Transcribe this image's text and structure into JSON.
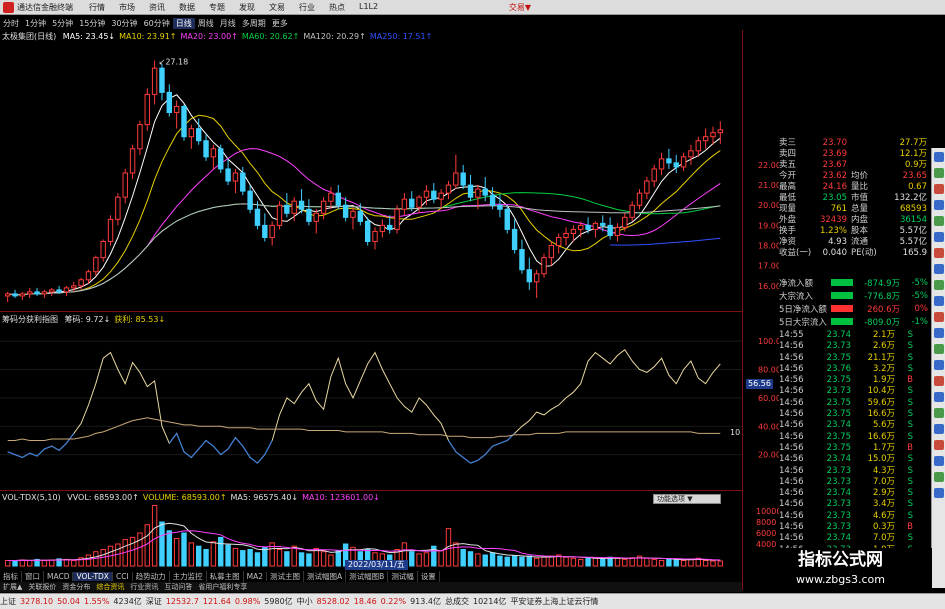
{
  "app": {
    "title": "通达信金融终端",
    "menu": [
      "行情",
      "市场",
      "资讯",
      "数据",
      "专题",
      "发现",
      "文易",
      "行业",
      "热点",
      "L1L2"
    ],
    "trade_label": "交易▼"
  },
  "periods": [
    {
      "label": "分时",
      "active": false
    },
    {
      "label": "1分钟",
      "active": false
    },
    {
      "label": "5分钟",
      "active": false
    },
    {
      "label": "15分钟",
      "active": false
    },
    {
      "label": "30分钟",
      "active": false
    },
    {
      "label": "60分钟",
      "active": false
    },
    {
      "label": "日线",
      "active": true
    },
    {
      "label": "周线",
      "active": false
    },
    {
      "label": "月线",
      "active": false
    },
    {
      "label": "多周期",
      "active": false
    },
    {
      "label": "更多",
      "active": false
    }
  ],
  "price_legend": {
    "name": "太极集团(日线)",
    "items": [
      {
        "text": "MA5: 23.45↓",
        "color": "#ffffff"
      },
      {
        "text": "MA10: 23.91↑",
        "color": "#e8d000"
      },
      {
        "text": "MA20: 23.00↑",
        "color": "#ff40ff"
      },
      {
        "text": "MA60: 20.62↑",
        "color": "#00d040"
      },
      {
        "text": "MA120: 20.29↑",
        "color": "#c0c0c0"
      },
      {
        "text": "MA250: 17.51↑",
        "color": "#3050ff"
      }
    ],
    "high_label": "27.18"
  },
  "price_axis": [
    "22.00",
    "21.00",
    "20.00",
    "19.00",
    "18.00",
    "17.00",
    "16.00"
  ],
  "indicator_legend": {
    "name": "筹码分获利指图",
    "items": [
      {
        "text": "筹码: 9.72↓",
        "color": "#e0e0e0"
      },
      {
        "text": "获利: 85.53↓",
        "color": "#e8d000"
      }
    ]
  },
  "indicator_axis": [
    "100.00",
    "80.00",
    "60.00",
    "40.00",
    "20.00"
  ],
  "indicator_marker": "56.56",
  "indicator_right_value": "10",
  "volume_legend": {
    "name": "VOL-TDX(5,10)",
    "items": [
      {
        "text": "VVOL: 68593.00↑",
        "color": "#e0e0e0"
      },
      {
        "text": "VOLUME: 68593.00↑",
        "color": "#e8d000"
      },
      {
        "text": "MA5: 96575.40↓",
        "color": "#e0e0e0"
      },
      {
        "text": "MA10: 123601.00↓",
        "color": "#ff40ff"
      }
    ]
  },
  "volume_axis": [
    "10000",
    "8000",
    "6000",
    "4000",
    "2000"
  ],
  "popup_label": "功能选项 ▼",
  "date_marker": "2022/03/11/五",
  "quote": [
    {
      "l": "卖三",
      "v": "23.70",
      "vc": "up",
      "l2": "",
      "v2": "27.7万",
      "v2c": "yl"
    },
    {
      "l": "卖四",
      "v": "23.69",
      "vc": "up",
      "l2": "",
      "v2": "12.1万",
      "v2c": "yl"
    },
    {
      "l": "卖五",
      "v": "23.67",
      "vc": "up",
      "l2": "",
      "v2": "0.9万",
      "v2c": "yl"
    },
    {
      "l": "今开",
      "v": "23.62",
      "vc": "up",
      "l2": "均价",
      "v2": "23.65",
      "v2c": "up"
    },
    {
      "l": "最高",
      "v": "24.16",
      "vc": "up",
      "l2": "量比",
      "v2": "0.67",
      "v2c": "yl"
    },
    {
      "l": "最低",
      "v": "23.05",
      "vc": "dn",
      "l2": "市值",
      "v2": "132.2亿",
      "v2c": "wh"
    },
    {
      "l": "现量",
      "v": "761",
      "vc": "yl",
      "l2": "总量",
      "v2": "68593",
      "v2c": "yl"
    },
    {
      "l": "外盘",
      "v": "32439",
      "vc": "up",
      "l2": "内盘",
      "v2": "36154",
      "v2c": "dn"
    },
    {
      "l": "换手",
      "v": "1.23%",
      "vc": "yl",
      "l2": "股本",
      "v2": "5.57亿",
      "v2c": "wh"
    },
    {
      "l": "净资",
      "v": "4.93",
      "vc": "wh",
      "l2": "流通",
      "v2": "5.57亿",
      "v2c": "wh"
    },
    {
      "l": "收益(一)",
      "v": "0.040",
      "vc": "wh",
      "l2": "PE(动)",
      "v2": "165.9",
      "v2c": "wh"
    }
  ],
  "flows": [
    {
      "l": "净流入额",
      "v": "-874.9万",
      "p": "-5%",
      "c": "dn"
    },
    {
      "l": "大宗流入",
      "v": "-776.8万",
      "p": "-5%",
      "c": "dn"
    },
    {
      "l": "5日净流入额",
      "v": "260.6万",
      "p": "0%",
      "c": "up"
    },
    {
      "l": "5日大宗流入",
      "v": "-809.0万",
      "p": "-1%",
      "c": "dn"
    }
  ],
  "ticks": [
    {
      "t": "14:55",
      "p": "23.74",
      "v": "2.1万",
      "s": "S",
      "sc": "dn"
    },
    {
      "t": "14:56",
      "p": "23.73",
      "v": "2.6万",
      "s": "S",
      "sc": "dn"
    },
    {
      "t": "14:56",
      "p": "23.75",
      "v": "21.1万",
      "s": "S",
      "sc": "dn"
    },
    {
      "t": "14:56",
      "p": "23.76",
      "v": "3.2万",
      "s": "S",
      "sc": "dn"
    },
    {
      "t": "14:56",
      "p": "23.75",
      "v": "1.9万",
      "s": "B",
      "sc": "up"
    },
    {
      "t": "14:56",
      "p": "23.73",
      "v": "10.4万",
      "s": "S",
      "sc": "dn"
    },
    {
      "t": "14:56",
      "p": "23.75",
      "v": "59.6万",
      "s": "S",
      "sc": "dn"
    },
    {
      "t": "14:56",
      "p": "23.75",
      "v": "16.6万",
      "s": "S",
      "sc": "dn"
    },
    {
      "t": "14:56",
      "p": "23.74",
      "v": "5.6万",
      "s": "S",
      "sc": "dn"
    },
    {
      "t": "14:56",
      "p": "23.75",
      "v": "16.6万",
      "s": "S",
      "sc": "dn"
    },
    {
      "t": "14:56",
      "p": "23.75",
      "v": "1.7万",
      "s": "B",
      "sc": "up"
    },
    {
      "t": "14:56",
      "p": "23.74",
      "v": "15.0万",
      "s": "S",
      "sc": "dn"
    },
    {
      "t": "14:56",
      "p": "23.73",
      "v": "4.3万",
      "s": "S",
      "sc": "dn"
    },
    {
      "t": "14:56",
      "p": "23.73",
      "v": "7.0万",
      "s": "S",
      "sc": "dn"
    },
    {
      "t": "14:56",
      "p": "23.74",
      "v": "2.9万",
      "s": "S",
      "sc": "dn"
    },
    {
      "t": "14:56",
      "p": "23.73",
      "v": "3.4万",
      "s": "S",
      "sc": "dn"
    },
    {
      "t": "14:56",
      "p": "23.73",
      "v": "4.6万",
      "s": "S",
      "sc": "dn"
    },
    {
      "t": "14:56",
      "p": "23.73",
      "v": "0.3万",
      "s": "B",
      "sc": "up"
    },
    {
      "t": "14:56",
      "p": "23.74",
      "v": "7.0万",
      "s": "S",
      "sc": "dn"
    },
    {
      "t": "14:56",
      "p": "23.73",
      "v": "1.0万",
      "s": "S",
      "sc": "dn"
    }
  ],
  "tabs": [
    {
      "label": "指标",
      "active": false
    },
    {
      "label": "窗口",
      "active": false
    },
    {
      "label": "MACD",
      "active": false
    },
    {
      "label": "VOL-TDX",
      "active": true
    },
    {
      "label": "CCI",
      "active": false
    },
    {
      "label": "趋势动力",
      "active": false
    },
    {
      "label": "主力监控",
      "active": false
    },
    {
      "label": "私募主图",
      "active": false
    },
    {
      "label": "MA2",
      "active": false
    },
    {
      "label": "测试主图",
      "active": false
    },
    {
      "label": "测试幅图A",
      "active": false
    },
    {
      "label": "测试幅图B",
      "active": false
    },
    {
      "label": "测试幅",
      "active": false
    },
    {
      "label": "设置",
      "active": false
    }
  ],
  "subtabs": [
    {
      "label": "扩展▲",
      "active": false
    },
    {
      "label": "关联报价",
      "active": false
    },
    {
      "label": "资金分布",
      "active": false
    },
    {
      "label": "综合资讯",
      "active": true
    },
    {
      "label": "行业资讯",
      "active": false
    },
    {
      "label": "互动问答",
      "active": false
    },
    {
      "label": "省用户福利专享",
      "active": false
    }
  ],
  "status": [
    {
      "text": "上证",
      "c": ""
    },
    {
      "text": "3278.10",
      "c": "sred"
    },
    {
      "text": "50.04",
      "c": "sred"
    },
    {
      "text": "1.55%",
      "c": "sred"
    },
    {
      "text": "4234亿",
      "c": ""
    },
    {
      "text": "深证",
      "c": ""
    },
    {
      "text": "12532.7",
      "c": "sred"
    },
    {
      "text": "121.64",
      "c": "sred"
    },
    {
      "text": "0.98%",
      "c": "sred"
    },
    {
      "text": "5980亿",
      "c": ""
    },
    {
      "text": "中小",
      "c": ""
    },
    {
      "text": "8528.02",
      "c": "sred"
    },
    {
      "text": "18.46",
      "c": "sred"
    },
    {
      "text": "0.22%",
      "c": "sred"
    },
    {
      "text": "913.4亿",
      "c": ""
    },
    {
      "text": "总成交",
      "c": ""
    },
    {
      "text": "10214亿",
      "c": ""
    },
    {
      "text": "平安证券上海上证云行情",
      "c": ""
    }
  ],
  "watermark": {
    "line1": "指标公式网",
    "line2": "www.zbgs3.com"
  },
  "chart_data": {
    "type": "candlestick",
    "ylim": [
      15.0,
      28.0
    ],
    "candles": [
      [
        15.5,
        15.7,
        15.2,
        15.6
      ],
      [
        15.6,
        15.8,
        15.4,
        15.5
      ],
      [
        15.5,
        15.7,
        15.3,
        15.6
      ],
      [
        15.6,
        15.9,
        15.4,
        15.7
      ],
      [
        15.7,
        15.9,
        15.5,
        15.6
      ],
      [
        15.6,
        15.8,
        15.4,
        15.7
      ],
      [
        15.7,
        15.9,
        15.5,
        15.8
      ],
      [
        15.8,
        16.0,
        15.6,
        15.7
      ],
      [
        15.7,
        16.0,
        15.5,
        15.9
      ],
      [
        15.9,
        16.2,
        15.7,
        16.0
      ],
      [
        16.0,
        16.4,
        15.8,
        16.3
      ],
      [
        16.3,
        16.8,
        16.1,
        16.7
      ],
      [
        16.7,
        17.5,
        16.5,
        17.4
      ],
      [
        17.4,
        18.3,
        17.2,
        18.2
      ],
      [
        18.2,
        19.5,
        18.0,
        19.3
      ],
      [
        19.3,
        20.6,
        19.0,
        20.4
      ],
      [
        20.4,
        21.8,
        20.1,
        21.6
      ],
      [
        21.6,
        23.0,
        21.3,
        22.8
      ],
      [
        22.8,
        24.2,
        22.5,
        24.0
      ],
      [
        24.0,
        25.8,
        23.7,
        25.5
      ],
      [
        25.5,
        27.18,
        25.0,
        26.8
      ],
      [
        26.8,
        27.0,
        25.2,
        25.6
      ],
      [
        25.6,
        26.0,
        24.4,
        24.6
      ],
      [
        24.6,
        25.2,
        23.8,
        24.9
      ],
      [
        24.9,
        25.0,
        23.2,
        23.4
      ],
      [
        23.4,
        24.0,
        22.8,
        23.8
      ],
      [
        23.8,
        24.3,
        23.0,
        23.2
      ],
      [
        23.2,
        23.5,
        22.2,
        22.4
      ],
      [
        22.4,
        23.0,
        21.8,
        22.8
      ],
      [
        22.8,
        23.0,
        21.6,
        21.8
      ],
      [
        21.8,
        22.3,
        21.0,
        21.2
      ],
      [
        21.2,
        21.8,
        20.6,
        21.6
      ],
      [
        21.6,
        21.9,
        20.5,
        20.7
      ],
      [
        20.7,
        21.0,
        19.6,
        19.8
      ],
      [
        19.8,
        20.2,
        18.8,
        19.0
      ],
      [
        19.0,
        19.6,
        18.2,
        18.4
      ],
      [
        18.4,
        19.2,
        18.0,
        19.0
      ],
      [
        19.0,
        20.2,
        18.8,
        20.0
      ],
      [
        20.0,
        20.6,
        19.4,
        19.6
      ],
      [
        19.6,
        20.4,
        19.2,
        20.2
      ],
      [
        20.2,
        20.8,
        19.6,
        19.8
      ],
      [
        19.8,
        20.3,
        19.0,
        19.2
      ],
      [
        19.2,
        19.8,
        18.6,
        19.6
      ],
      [
        19.6,
        20.4,
        19.3,
        20.2
      ],
      [
        20.2,
        20.9,
        19.8,
        20.6
      ],
      [
        20.6,
        21.0,
        19.8,
        20.0
      ],
      [
        20.0,
        20.4,
        19.2,
        19.4
      ],
      [
        19.4,
        19.9,
        18.8,
        19.7
      ],
      [
        19.7,
        20.1,
        19.0,
        19.2
      ],
      [
        19.2,
        19.4,
        18.0,
        18.2
      ],
      [
        18.2,
        18.9,
        17.8,
        18.7
      ],
      [
        18.7,
        19.3,
        18.4,
        19.0
      ],
      [
        19.0,
        19.5,
        18.6,
        18.8
      ],
      [
        18.8,
        20.0,
        18.6,
        19.8
      ],
      [
        19.8,
        20.6,
        19.5,
        20.3
      ],
      [
        20.3,
        20.7,
        19.7,
        19.9
      ],
      [
        19.9,
        20.5,
        19.6,
        20.4
      ],
      [
        20.4,
        21.0,
        20.0,
        20.7
      ],
      [
        20.7,
        21.1,
        20.1,
        20.3
      ],
      [
        20.3,
        20.8,
        19.8,
        20.6
      ],
      [
        20.6,
        21.2,
        20.3,
        21.0
      ],
      [
        21.0,
        22.5,
        20.8,
        21.6
      ],
      [
        21.6,
        22.0,
        20.8,
        21.0
      ],
      [
        21.0,
        21.5,
        20.2,
        20.4
      ],
      [
        20.4,
        21.0,
        19.8,
        20.8
      ],
      [
        20.8,
        21.4,
        20.2,
        20.5
      ],
      [
        20.5,
        20.9,
        19.8,
        20.0
      ],
      [
        20.0,
        20.5,
        19.4,
        19.8
      ],
      [
        19.8,
        20.0,
        18.6,
        18.8
      ],
      [
        18.8,
        19.3,
        17.6,
        17.8
      ],
      [
        17.8,
        18.3,
        16.6,
        16.8
      ],
      [
        16.8,
        17.4,
        15.8,
        16.2
      ],
      [
        16.2,
        16.8,
        15.4,
        16.6
      ],
      [
        16.6,
        17.6,
        16.4,
        17.4
      ],
      [
        17.4,
        18.2,
        17.0,
        18.0
      ],
      [
        18.0,
        18.6,
        17.6,
        18.4
      ],
      [
        18.4,
        18.9,
        18.0,
        18.6
      ],
      [
        18.6,
        19.0,
        18.2,
        18.8
      ],
      [
        18.8,
        19.2,
        18.4,
        19.0
      ],
      [
        19.0,
        19.4,
        18.6,
        18.8
      ],
      [
        18.8,
        19.2,
        18.4,
        19.1
      ],
      [
        19.1,
        19.5,
        18.7,
        19.0
      ],
      [
        19.0,
        19.4,
        18.3,
        18.5
      ],
      [
        18.5,
        19.1,
        18.2,
        18.9
      ],
      [
        18.9,
        19.6,
        18.7,
        19.4
      ],
      [
        19.4,
        20.2,
        19.2,
        20.0
      ],
      [
        20.0,
        20.8,
        19.8,
        20.6
      ],
      [
        20.6,
        21.4,
        20.3,
        21.2
      ],
      [
        21.2,
        22.0,
        20.9,
        21.8
      ],
      [
        21.8,
        22.6,
        21.5,
        22.3
      ],
      [
        22.3,
        22.8,
        21.8,
        22.1
      ],
      [
        22.1,
        22.5,
        21.6,
        21.9
      ],
      [
        21.9,
        22.6,
        21.7,
        22.4
      ],
      [
        22.4,
        23.0,
        22.0,
        22.7
      ],
      [
        22.7,
        23.4,
        22.4,
        23.2
      ],
      [
        23.2,
        23.8,
        22.8,
        23.4
      ],
      [
        23.4,
        23.9,
        23.0,
        23.6
      ],
      [
        23.6,
        24.16,
        23.05,
        23.74
      ]
    ],
    "volume": [
      1.0,
      1.0,
      1.1,
      1.0,
      1.2,
      1.0,
      1.1,
      1.3,
      1.2,
      1.0,
      1.5,
      2.0,
      2.6,
      3.0,
      3.6,
      4.0,
      4.8,
      5.2,
      6.0,
      7.5,
      11.0,
      8.0,
      6.4,
      5.0,
      6.0,
      4.2,
      3.6,
      3.0,
      4.4,
      5.2,
      3.8,
      3.2,
      2.8,
      3.0,
      2.4,
      3.4,
      4.2,
      3.0,
      2.6,
      3.6,
      2.4,
      2.2,
      3.2,
      2.6,
      2.0,
      2.8,
      4.0,
      3.4,
      2.6,
      3.0,
      2.4,
      2.2,
      2.0,
      3.0,
      4.2,
      2.6,
      2.2,
      2.4,
      3.6,
      2.8,
      6.8,
      4.2,
      3.0,
      2.6,
      2.2,
      2.0,
      2.4,
      1.8,
      1.6,
      1.8,
      1.6,
      1.8,
      1.4,
      1.6,
      1.8,
      2.0,
      1.6,
      1.4,
      1.2,
      1.5,
      1.4,
      1.3,
      1.6,
      1.4,
      1.2,
      1.5,
      1.8,
      1.4,
      1.2,
      1.0,
      1.3,
      1.1,
      1.0,
      1.2,
      1.4,
      1.0,
      0.9,
      0.9
    ],
    "indicator_chip": [
      22,
      20,
      18,
      21,
      19,
      24,
      26,
      23,
      28,
      35,
      42,
      55,
      70,
      88,
      92,
      80,
      70,
      85,
      78,
      68,
      72,
      40,
      28,
      35,
      22,
      18,
      24,
      30,
      26,
      20,
      24,
      32,
      26,
      18,
      14,
      20,
      30,
      48,
      60,
      56,
      64,
      70,
      58,
      52,
      75,
      88,
      70,
      60,
      72,
      84,
      92,
      80,
      70,
      60,
      54,
      50,
      60,
      55,
      48,
      42,
      30,
      22,
      18,
      14,
      16,
      20,
      26,
      28,
      30,
      35,
      40,
      44,
      50,
      48,
      52,
      55,
      60,
      64,
      70,
      86,
      92,
      88,
      84,
      90,
      94,
      86,
      80,
      78,
      82,
      88,
      76,
      70,
      80,
      86,
      74,
      70,
      78,
      84
    ],
    "indicator_profit": [
      30,
      30,
      31,
      30,
      30,
      30,
      31,
      31,
      31,
      31,
      32,
      33,
      35,
      36,
      38,
      40,
      42,
      44,
      45,
      46,
      45,
      44,
      43,
      42,
      41,
      41,
      40,
      40,
      40,
      40,
      39,
      39,
      39,
      39,
      38,
      38,
      38,
      38,
      38,
      38,
      38,
      37,
      37,
      37,
      37,
      37,
      36,
      36,
      36,
      36,
      36,
      36,
      35,
      35,
      35,
      35,
      34,
      34,
      34,
      34,
      33,
      33,
      33,
      32,
      32,
      32,
      32,
      33,
      33,
      34,
      34,
      34,
      35,
      35,
      35,
      35,
      36,
      36,
      36,
      36,
      36,
      36,
      36,
      36,
      36,
      36,
      36,
      36,
      36,
      36,
      36,
      36,
      36,
      36,
      35,
      35,
      35,
      35
    ]
  }
}
